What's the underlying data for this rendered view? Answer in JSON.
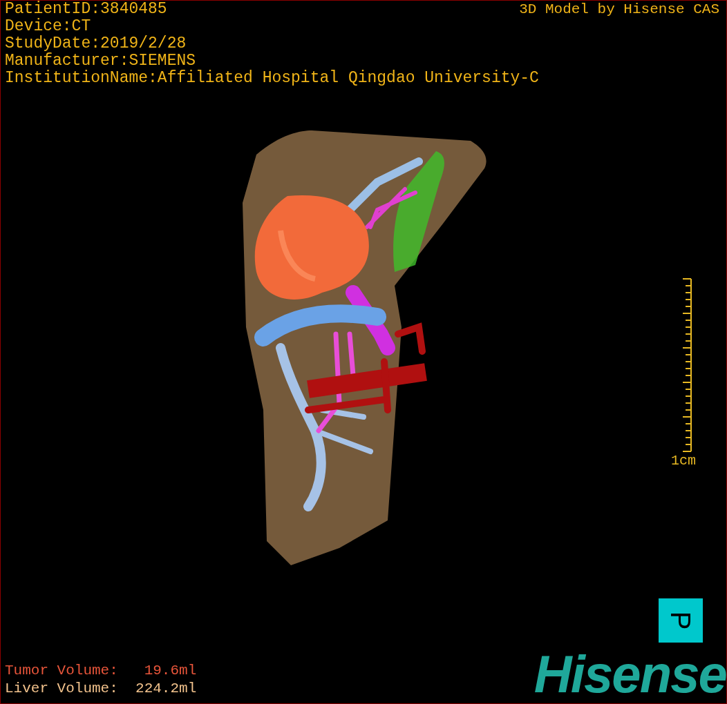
{
  "patient_info": [
    "PatientID:3840485",
    "Device:CT",
    "StudyDate:2019/2/28",
    "Manufacturer:SIEMENS",
    "InstitutionName:Affiliated Hospital Qingdao University-C"
  ],
  "credit": "3D Model by Hisense CAS",
  "scale": {
    "label": "1cm"
  },
  "orientation_marker": {
    "label": "P"
  },
  "volumes": [
    {
      "text": "Tumor Volume:   19.6ml",
      "color": "#e8553a"
    },
    {
      "text": "Liver Volume:  224.2ml",
      "color": "#f2c28c"
    }
  ],
  "logo": "Hisense"
}
